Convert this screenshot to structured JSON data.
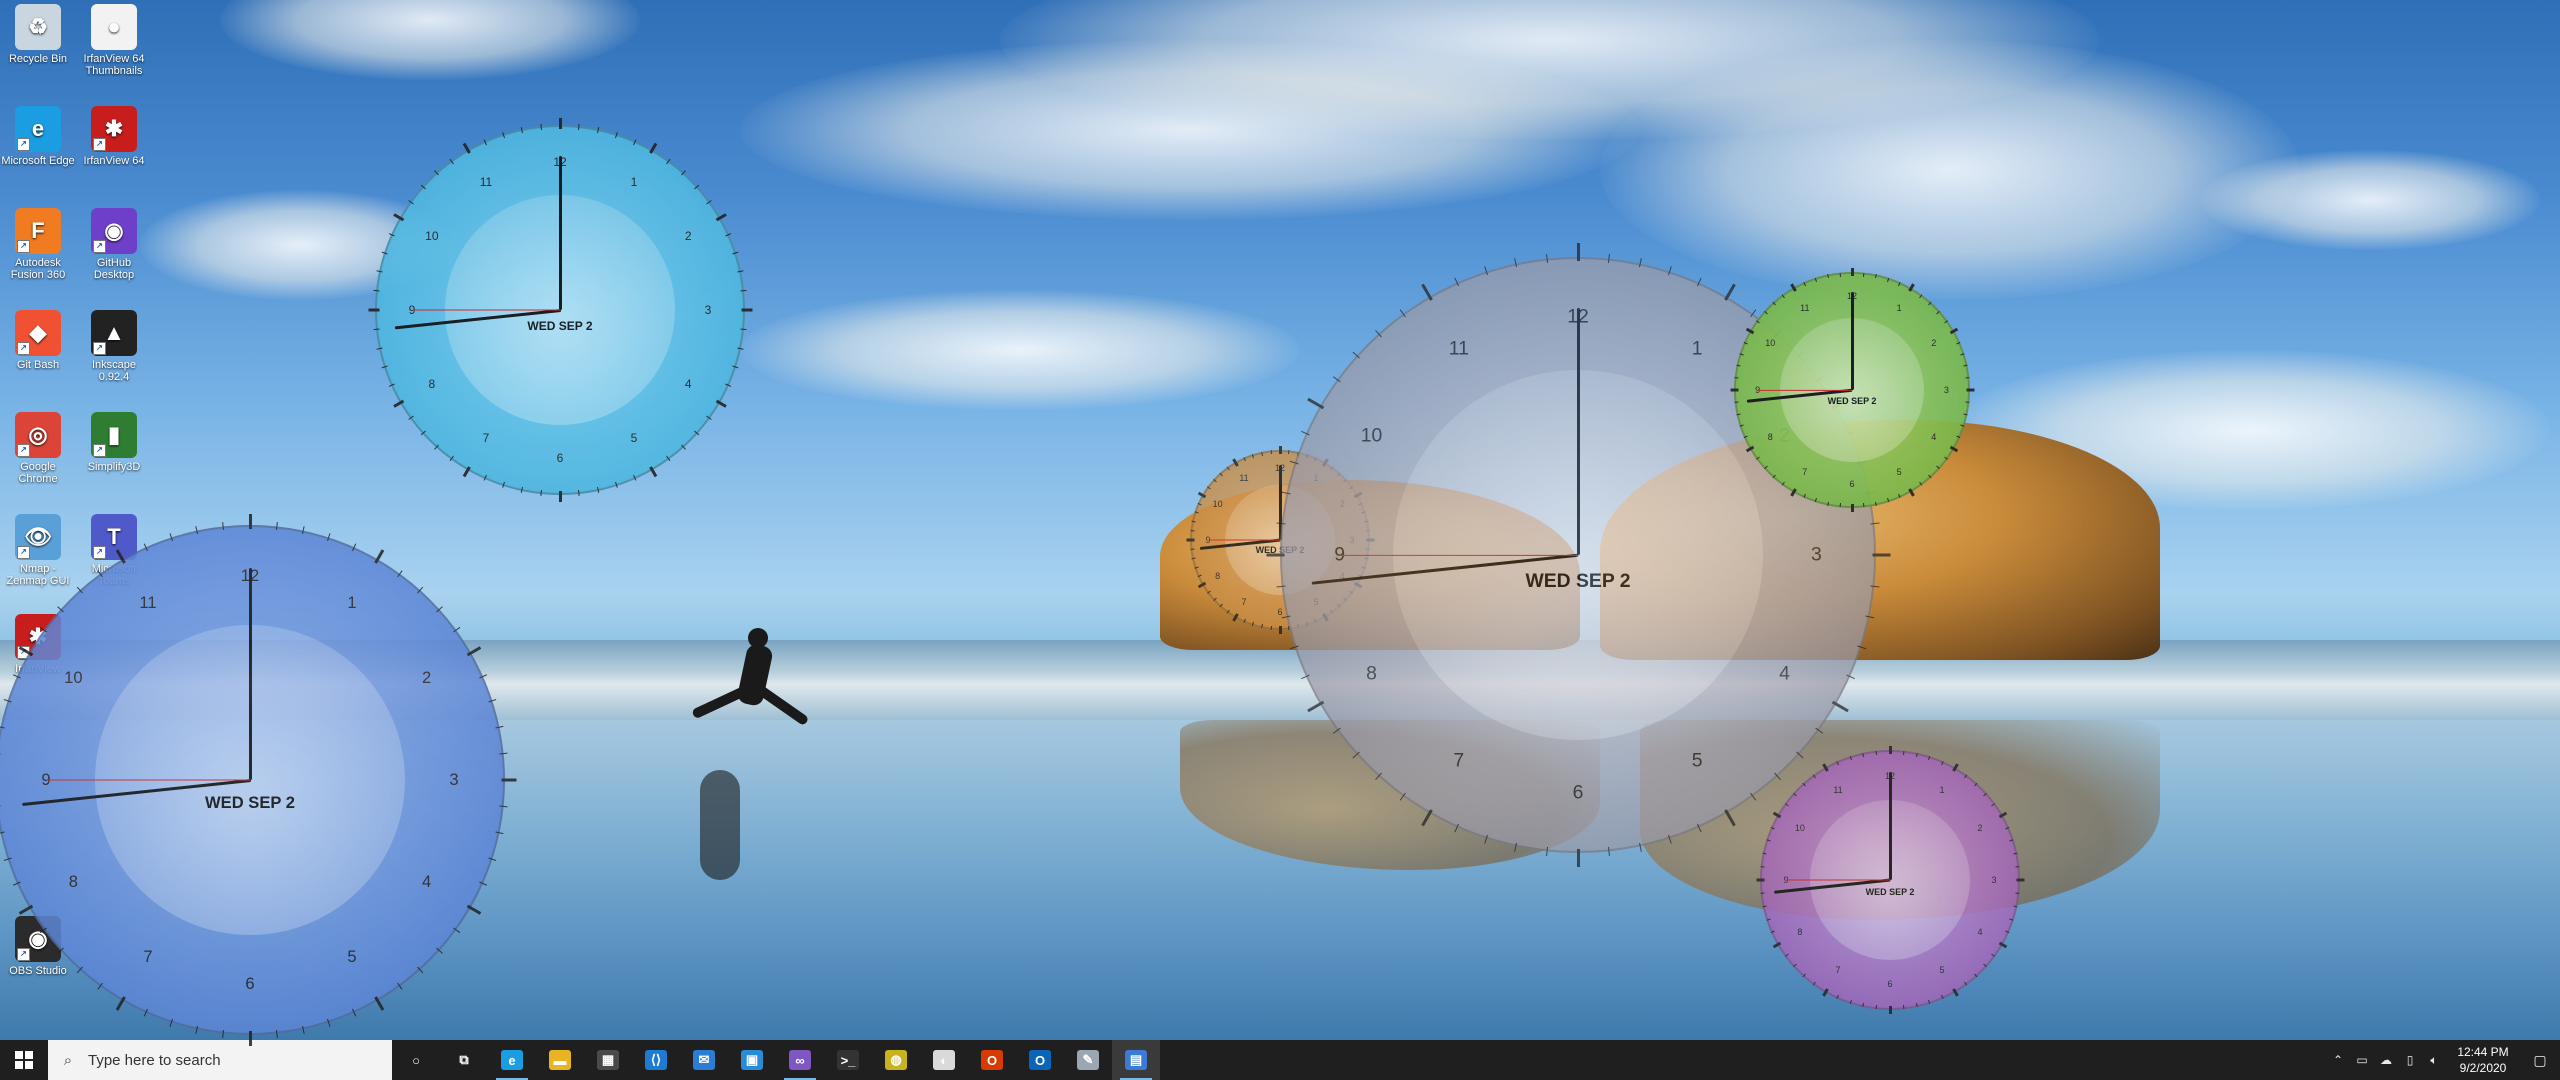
{
  "desktop": {
    "icons": [
      {
        "label": "Recycle Bin",
        "icon": "recycle-bin-icon",
        "color": "#c9d6e0",
        "glyph": "♻"
      },
      {
        "label": "IrfanView 64 Thumbnails",
        "icon": "panda-icon",
        "color": "#f2f2f2",
        "glyph": "●"
      },
      {
        "label": "Microsoft Edge",
        "icon": "edge-icon",
        "color": "#1b9de2",
        "glyph": "e"
      },
      {
        "label": "IrfanView 64",
        "icon": "irfanview-icon",
        "color": "#c81d1d",
        "glyph": "✱"
      },
      {
        "label": "Autodesk Fusion 360",
        "icon": "fusion-360-icon",
        "color": "#f07b21",
        "glyph": "F"
      },
      {
        "label": "GitHub Desktop",
        "icon": "github-icon",
        "color": "#6e40c9",
        "glyph": "◉"
      },
      {
        "label": "Git Bash",
        "icon": "git-bash-icon",
        "color": "#f05133",
        "glyph": "◆"
      },
      {
        "label": "Inkscape 0.92.4",
        "icon": "inkscape-icon",
        "color": "#222222",
        "glyph": "▲"
      },
      {
        "label": "Google Chrome",
        "icon": "chrome-icon",
        "color": "#db4437",
        "glyph": "◎"
      },
      {
        "label": "Simplify3D",
        "icon": "simplify3d-icon",
        "color": "#2e7d32",
        "glyph": "▮"
      },
      {
        "label": "Nmap - Zenmap GUI",
        "icon": "zenmap-icon",
        "color": "#5aa0d8",
        "glyph": "👁"
      },
      {
        "label": "Microsoft Teams",
        "icon": "teams-icon",
        "color": "#5059c9",
        "glyph": "T"
      },
      {
        "label": "IrfanView",
        "icon": "irfanview-icon",
        "color": "#c81d1d",
        "glyph": "✱"
      },
      {
        "label": "OBS Studio",
        "icon": "obs-icon",
        "color": "#2b2b2b",
        "glyph": "◉"
      }
    ]
  },
  "clocks": [
    {
      "name": "clock-cyan",
      "date": "WED SEP 2",
      "face": "#4fb7e0",
      "inner": "#7fd2f0",
      "hour_deg": 0,
      "minute_deg": 264,
      "second_deg": 270
    },
    {
      "name": "clock-blue",
      "date": "WED SEP 2",
      "face": "#5d86d6",
      "inner": "#8fb0e8",
      "hour_deg": 0,
      "minute_deg": 264,
      "second_deg": 270
    },
    {
      "name": "clock-grey",
      "date": "WED SEP 2",
      "face": "#9a9aa8",
      "inner": "#d9d4dc",
      "hour_deg": 0,
      "minute_deg": 264,
      "second_deg": 270
    },
    {
      "name": "clock-orange",
      "date": "WED SEP 2",
      "face": "#c98d45",
      "inner": "#d9a66a",
      "hour_deg": 0,
      "minute_deg": 264,
      "second_deg": 270
    },
    {
      "name": "clock-green",
      "date": "WED SEP 2",
      "face": "#78b84a",
      "inner": "#a6d16f",
      "hour_deg": 0,
      "minute_deg": 264,
      "second_deg": 270
    },
    {
      "name": "clock-purple",
      "date": "WED SEP 2",
      "face": "#a465b8",
      "inner": "#c99ad6",
      "hour_deg": 0,
      "minute_deg": 264,
      "second_deg": 270
    }
  ],
  "taskbar": {
    "search_placeholder": "Type here to search",
    "apps": [
      {
        "name": "cortana-icon",
        "glyph": "○",
        "color": "transparent"
      },
      {
        "name": "task-view-icon",
        "glyph": "⧉",
        "color": "transparent"
      },
      {
        "name": "edge-icon",
        "glyph": "e",
        "color": "#1b9de2",
        "running": true
      },
      {
        "name": "file-explorer-icon",
        "glyph": "▬",
        "color": "#e8b424"
      },
      {
        "name": "store-icon",
        "glyph": "▦",
        "color": "#4a4a4a"
      },
      {
        "name": "vscode-icon",
        "glyph": "⟨⟩",
        "color": "#1f7ad1"
      },
      {
        "name": "mail-icon",
        "glyph": "✉",
        "color": "#2b7cd3"
      },
      {
        "name": "sandbox-icon",
        "glyph": "▣",
        "color": "#2a8bd6"
      },
      {
        "name": "visual-studio-icon",
        "glyph": "∞",
        "color": "#7e57c2",
        "running": true
      },
      {
        "name": "terminal-icon",
        "glyph": ">_",
        "color": "#333333"
      },
      {
        "name": "globe-app-icon",
        "glyph": "◍",
        "color": "#c9b21f"
      },
      {
        "name": "paint-icon",
        "glyph": "◐",
        "color": "#d9d9d9"
      },
      {
        "name": "office-icon",
        "glyph": "O",
        "color": "#d83b01"
      },
      {
        "name": "outlook-icon",
        "glyph": "O",
        "color": "#0a64b7"
      },
      {
        "name": "settings-app-icon",
        "glyph": "✎",
        "color": "#9aa6b2"
      },
      {
        "name": "clock-app-icon",
        "glyph": "▤",
        "color": "#3b7bd6",
        "running": true,
        "active": true
      }
    ],
    "tray": {
      "time": "12:44 PM",
      "date": "9/2/2020"
    }
  },
  "colors": {
    "taskbar_bg": "#1f1f1f",
    "running_indicator": "#76b9ed",
    "second_hand": "#d21f1f"
  }
}
